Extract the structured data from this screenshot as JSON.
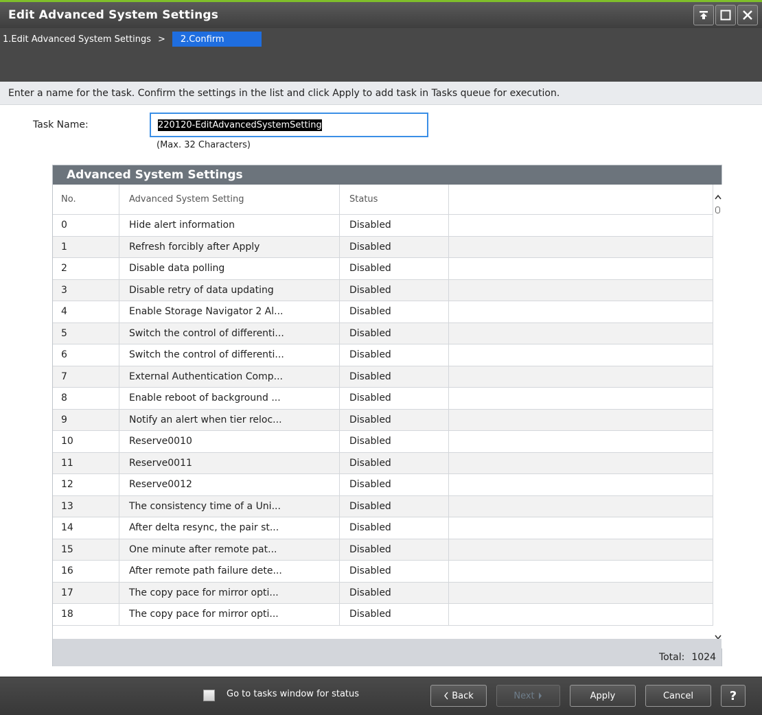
{
  "window": {
    "title": "Edit Advanced System Settings"
  },
  "steps": {
    "step1": "1.Edit Advanced System Settings",
    "separator": ">",
    "step2": "2.Confirm"
  },
  "instruction": "Enter a name for the task. Confirm the settings in the list and click Apply to add task in Tasks queue for execution.",
  "task": {
    "label": "Task Name:",
    "value": "220120-EditAdvancedSystemSetting",
    "hint": "(Max. 32 Characters)"
  },
  "panel": {
    "title": "Advanced System Settings",
    "columns": [
      "No.",
      "Advanced System Setting",
      "Status",
      ""
    ],
    "rows": [
      [
        "0",
        "Hide alert information",
        "Disabled"
      ],
      [
        "1",
        "Refresh forcibly after Apply",
        "Disabled"
      ],
      [
        "2",
        "Disable data polling",
        "Disabled"
      ],
      [
        "3",
        "Disable retry of data updating",
        "Disabled"
      ],
      [
        "4",
        "Enable Storage Navigator 2 Al...",
        "Disabled"
      ],
      [
        "5",
        "Switch the control of differenti...",
        "Disabled"
      ],
      [
        "6",
        "Switch the control of differenti...",
        "Disabled"
      ],
      [
        "7",
        "External Authentication Comp...",
        "Disabled"
      ],
      [
        "8",
        "Enable reboot of background ...",
        "Disabled"
      ],
      [
        "9",
        "Notify an alert when tier reloc...",
        "Disabled"
      ],
      [
        "10",
        "Reserve0010",
        "Disabled"
      ],
      [
        "11",
        "Reserve0011",
        "Disabled"
      ],
      [
        "12",
        "Reserve0012",
        "Disabled"
      ],
      [
        "13",
        "The consistency time of a Uni...",
        "Disabled"
      ],
      [
        "14",
        "After delta resync, the pair st...",
        "Disabled"
      ],
      [
        "15",
        "One minute after remote pat...",
        "Disabled"
      ],
      [
        "16",
        "After remote path failure dete...",
        "Disabled"
      ],
      [
        "17",
        "The copy pace for mirror opti...",
        "Disabled"
      ],
      [
        "18",
        "The copy pace for mirror opti...",
        "Disabled"
      ]
    ],
    "total_label": "Total:",
    "total_value": "1024"
  },
  "footer": {
    "checkbox_label": "Go to tasks window for status",
    "checkbox_checked": false,
    "back": "Back",
    "next": "Next",
    "apply": "Apply",
    "cancel": "Cancel",
    "help": "?"
  },
  "icons": {
    "pin": "pin-icon",
    "maximize": "maximize-icon",
    "close": "close-icon"
  },
  "colors": {
    "accent_top": "#7fbf2a",
    "active_step": "#1f6ee0",
    "input_border": "#3a8ee6",
    "panel_header": "#6c747c"
  }
}
